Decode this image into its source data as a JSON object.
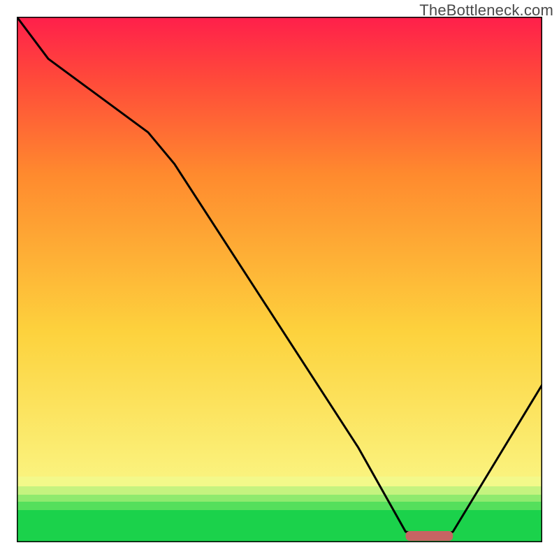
{
  "watermark": "TheBottleneck.com",
  "chart_data": {
    "type": "line",
    "title": "",
    "xlabel": "",
    "ylabel": "",
    "xlim": [
      0,
      100
    ],
    "ylim": [
      0,
      100
    ],
    "grid": false,
    "legend": false,
    "background_gradient_stops": [
      {
        "offset": 0.0,
        "color": "#1bd24b"
      },
      {
        "offset": 0.03,
        "color": "#8ee86d"
      },
      {
        "offset": 0.07,
        "color": "#faf98a"
      },
      {
        "offset": 0.4,
        "color": "#fdd23d"
      },
      {
        "offset": 0.7,
        "color": "#ff8a2e"
      },
      {
        "offset": 0.88,
        "color": "#ff4a3a"
      },
      {
        "offset": 1.0,
        "color": "#ff1f4b"
      }
    ],
    "series": [
      {
        "name": "bottleneck-curve",
        "x": [
          0,
          6,
          25,
          30,
          65,
          74,
          80,
          83,
          100
        ],
        "y": [
          100,
          92,
          78,
          72,
          18,
          2,
          1,
          2,
          30
        ]
      }
    ],
    "marker": {
      "name": "optimal-range",
      "x_start": 74,
      "x_end": 83,
      "y": 1.2,
      "color": "#c76463"
    }
  }
}
